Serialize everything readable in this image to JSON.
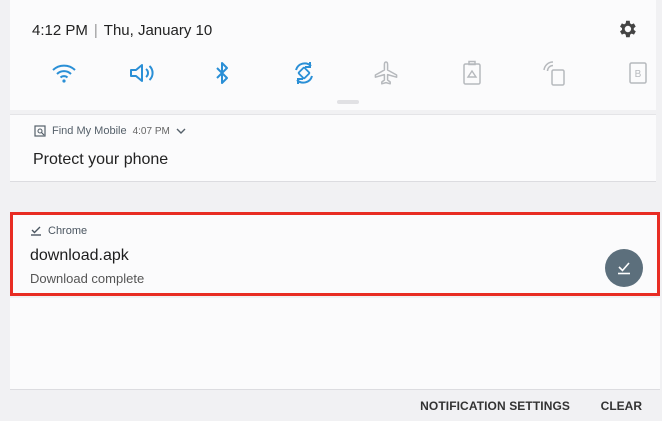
{
  "status": {
    "time": "4:12 PM",
    "separator": "|",
    "date": "Thu, January 10"
  },
  "quick_settings": [
    {
      "name": "wifi-icon",
      "active": true
    },
    {
      "name": "sound-icon",
      "active": true
    },
    {
      "name": "bluetooth-icon",
      "active": true
    },
    {
      "name": "auto-rotate-icon",
      "active": true
    },
    {
      "name": "airplane-mode-icon",
      "active": false
    },
    {
      "name": "power-saving-icon",
      "active": false
    },
    {
      "name": "mobile-hotspot-icon",
      "active": false
    },
    {
      "name": "blue-light-filter-icon",
      "active": false
    }
  ],
  "colors": {
    "accent": "#2a8fd6",
    "inactive_icon": "#b6b9bd",
    "highlight_border": "#e82c23",
    "action_button": "#5c6f7c"
  },
  "notifications": {
    "find_my_mobile": {
      "app": "Find My Mobile",
      "time": "4:07 PM",
      "title": "Protect your phone"
    },
    "chrome": {
      "app": "Chrome",
      "title": "download.apk",
      "subtitle": "Download complete"
    }
  },
  "footer": {
    "notification_settings": "NOTIFICATION SETTINGS",
    "clear": "CLEAR"
  }
}
